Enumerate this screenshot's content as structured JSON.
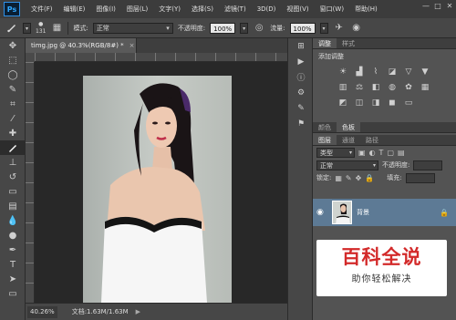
{
  "app": {
    "logo": "Ps"
  },
  "menu": [
    "文件(F)",
    "编辑(E)",
    "图像(I)",
    "图层(L)",
    "文字(Y)",
    "选择(S)",
    "滤镜(T)",
    "3D(D)",
    "视图(V)",
    "窗口(W)",
    "帮助(H)"
  ],
  "window_controls": {
    "minimize": "—",
    "maximize": "□",
    "close": "✕"
  },
  "options": {
    "brush_size": "131",
    "mode_label": "模式:",
    "mode_value": "正常",
    "opacity_label": "不透明度:",
    "opacity_value": "100%",
    "flow_label": "流量:",
    "flow_value": "100%"
  },
  "document": {
    "tab_title": "timg.jpg @ 40.3%(RGB/8#) *",
    "close": "×",
    "zoom": "40.26%",
    "doc_info": "文档:1.63M/1.63M",
    "arrow": "▶"
  },
  "adjust_panel": {
    "tabs": [
      "调整",
      "样式"
    ],
    "title": "添加调整",
    "row1_icons": [
      "brightness-icon",
      "levels-icon",
      "curves-icon",
      "exposure-icon",
      "vibrance-icon",
      "triangle-icon"
    ],
    "row2_icons": [
      "hue-icon",
      "balance-icon",
      "bw-icon",
      "photo-filter-icon",
      "mixer-icon",
      "grid-icon"
    ],
    "row3_icons": [
      "invert-icon",
      "posterize-icon",
      "threshold-icon",
      "selective-color-icon",
      "gradient-map-icon"
    ]
  },
  "layers_panel": {
    "tabs_top": [
      "颜色",
      "色板"
    ],
    "tabs": [
      "图层",
      "通道",
      "路径"
    ],
    "kind_label": "类型",
    "blend_mode": "正常",
    "opacity_label": "不透明度:",
    "lock_label": "锁定:",
    "fill_label": "填充:",
    "layer_name": "背景",
    "lock_icon": "🔒"
  },
  "watermark": {
    "title": "百科全说",
    "subtitle": "助你轻松解决"
  },
  "colors": {
    "accent": "#5d7a95",
    "watermark_red": "#d32a2a"
  }
}
